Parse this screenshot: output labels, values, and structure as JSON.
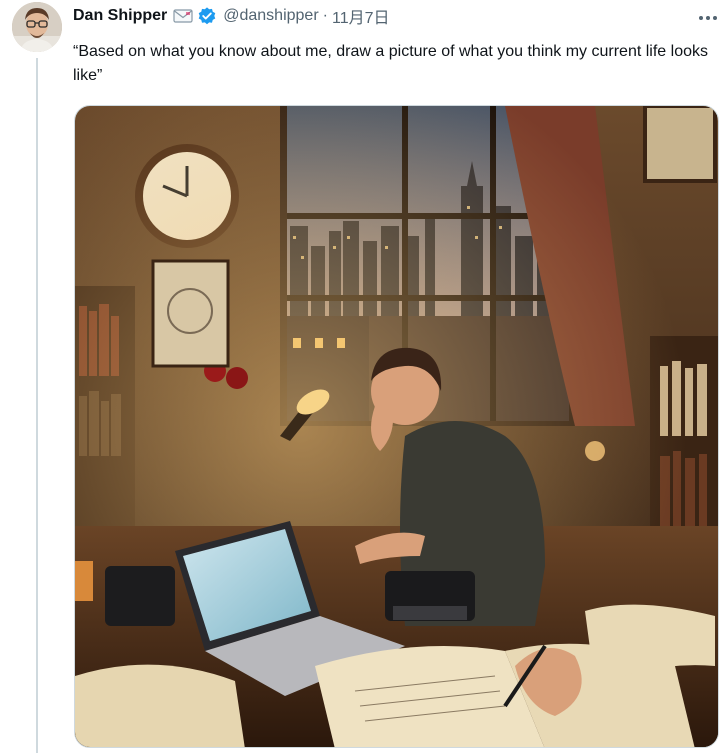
{
  "tweet": {
    "author_name": "Dan Shipper",
    "author_handle": "@danshipper",
    "separator": "·",
    "date": "11月7日",
    "text": "“Based on what you know about me, draw a picture of what you think my current life looks like”",
    "author_emoji": "mail-icon",
    "verified": true,
    "verified_color": "#1d9bf0"
  },
  "media": {
    "alt_text": ""
  },
  "icons": {
    "more": "more-horizontal-icon",
    "verified": "verified-badge-icon",
    "mail": "envelope-icon"
  }
}
